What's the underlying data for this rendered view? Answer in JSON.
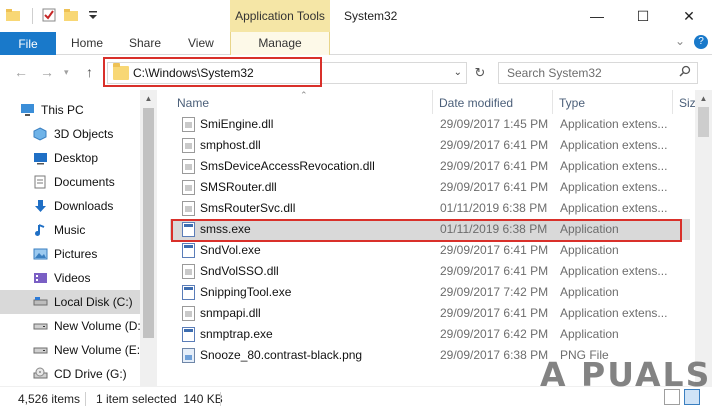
{
  "titlebar": {
    "context_tab_label": "Application Tools",
    "window_title": "System32",
    "minimize_glyph": "—",
    "maximize_glyph": "☐",
    "close_glyph": "✕"
  },
  "ribbon": {
    "file_label": "File",
    "tabs": [
      "Home",
      "Share",
      "View"
    ],
    "context_label": "Manage",
    "help_glyph": "?"
  },
  "address": {
    "path": "C:\\Windows\\System32",
    "search_placeholder": "Search System32"
  },
  "nav": {
    "items": [
      {
        "label": "This PC",
        "icon": "computer-icon",
        "selected": false
      },
      {
        "label": "3D Objects",
        "icon": "3d-objects-icon",
        "selected": false
      },
      {
        "label": "Desktop",
        "icon": "desktop-icon",
        "selected": false
      },
      {
        "label": "Documents",
        "icon": "documents-icon",
        "selected": false
      },
      {
        "label": "Downloads",
        "icon": "downloads-icon",
        "selected": false
      },
      {
        "label": "Music",
        "icon": "music-icon",
        "selected": false
      },
      {
        "label": "Pictures",
        "icon": "pictures-icon",
        "selected": false
      },
      {
        "label": "Videos",
        "icon": "videos-icon",
        "selected": false
      },
      {
        "label": "Local Disk (C:)",
        "icon": "drive-icon",
        "selected": true
      },
      {
        "label": "New Volume (D:",
        "icon": "drive-icon",
        "selected": false
      },
      {
        "label": "New Volume (E:)",
        "icon": "drive-icon",
        "selected": false
      },
      {
        "label": "CD Drive (G:)",
        "icon": "cd-drive-icon",
        "selected": false
      }
    ]
  },
  "columns": {
    "name": "Name",
    "date": "Date modified",
    "type": "Type",
    "size": "Siz"
  },
  "files": [
    {
      "name": "SmiEngine.dll",
      "date": "29/09/2017 1:45 PM",
      "type": "Application extens...",
      "kind": "dll",
      "selected": false
    },
    {
      "name": "smphost.dll",
      "date": "29/09/2017 6:41 PM",
      "type": "Application extens...",
      "kind": "dll",
      "selected": false
    },
    {
      "name": "SmsDeviceAccessRevocation.dll",
      "date": "29/09/2017 6:41 PM",
      "type": "Application extens...",
      "kind": "dll",
      "selected": false
    },
    {
      "name": "SMSRouter.dll",
      "date": "29/09/2017 6:41 PM",
      "type": "Application extens...",
      "kind": "dll",
      "selected": false
    },
    {
      "name": "SmsRouterSvc.dll",
      "date": "01/11/2019 6:38 PM",
      "type": "Application extens...",
      "kind": "dll",
      "selected": false
    },
    {
      "name": "smss.exe",
      "date": "01/11/2019 6:38 PM",
      "type": "Application",
      "kind": "exe",
      "selected": true
    },
    {
      "name": "SndVol.exe",
      "date": "29/09/2017 6:41 PM",
      "type": "Application",
      "kind": "exe",
      "selected": false
    },
    {
      "name": "SndVolSSO.dll",
      "date": "29/09/2017 6:41 PM",
      "type": "Application extens...",
      "kind": "dll",
      "selected": false
    },
    {
      "name": "SnippingTool.exe",
      "date": "29/09/2017 7:42 PM",
      "type": "Application",
      "kind": "exe",
      "selected": false
    },
    {
      "name": "snmpapi.dll",
      "date": "29/09/2017 6:41 PM",
      "type": "Application extens...",
      "kind": "dll",
      "selected": false
    },
    {
      "name": "snmptrap.exe",
      "date": "29/09/2017 6:42 PM",
      "type": "Application",
      "kind": "exe",
      "selected": false
    },
    {
      "name": "Snooze_80.contrast-black.png",
      "date": "29/09/2017 6:38 PM",
      "type": "PNG File",
      "kind": "png",
      "selected": false
    }
  ],
  "status": {
    "item_count": "4,526 items",
    "selection": "1 item selected  140 KB"
  },
  "watermark": "A  PUALS",
  "colors": {
    "file_tab": "#1979ca",
    "context_tab": "#f5e6a6",
    "selection": "#d9d9d9",
    "highlight": "#d9302a"
  }
}
